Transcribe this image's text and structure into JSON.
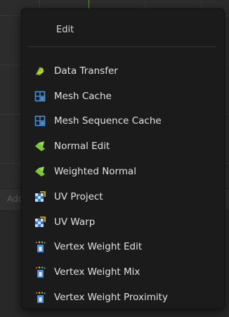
{
  "background": {
    "header_text": "Add"
  },
  "menu": {
    "title": "Edit",
    "items": [
      {
        "label": "Data Transfer",
        "icon": "data-transfer-icon"
      },
      {
        "label": "Mesh Cache",
        "icon": "mesh-cache-icon"
      },
      {
        "label": "Mesh Sequence Cache",
        "icon": "mesh-sequence-cache-icon"
      },
      {
        "label": "Normal Edit",
        "icon": "normal-edit-icon"
      },
      {
        "label": "Weighted Normal",
        "icon": "weighted-normal-icon"
      },
      {
        "label": "UV Project",
        "icon": "uv-project-icon"
      },
      {
        "label": "UV Warp",
        "icon": "uv-warp-icon"
      },
      {
        "label": "Vertex Weight Edit",
        "icon": "vertex-weight-edit-icon"
      },
      {
        "label": "Vertex Weight Mix",
        "icon": "vertex-weight-mix-icon"
      },
      {
        "label": "Vertex Weight Proximity",
        "icon": "vertex-weight-proximity-icon"
      }
    ]
  },
  "colors": {
    "menu_background": "#1b1b1b",
    "menu_text": "#e2e2e2",
    "icon_green": "#7ec63a",
    "icon_yellow": "#e6c72a",
    "icon_blue": "#4a8fd8"
  }
}
